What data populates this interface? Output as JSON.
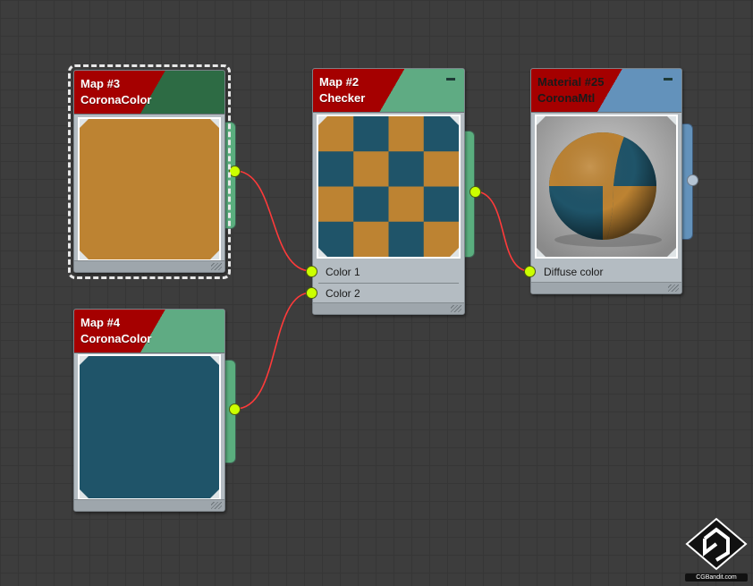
{
  "nodes": {
    "map3": {
      "title": "Map #3",
      "subtitle": "CoronaColor",
      "swatch": "#bd8332"
    },
    "map4": {
      "title": "Map #4",
      "subtitle": "CoronaColor",
      "swatch": "#1f5469"
    },
    "map2": {
      "title": "Map #2",
      "subtitle": "Checker",
      "slots": [
        "Color 1",
        "Color 2"
      ]
    },
    "material25": {
      "title": "Material #25",
      "subtitle": "CoronaMtl",
      "slots": [
        "Diffuse color"
      ]
    }
  },
  "colors": {
    "canvas": "#3d3d3d",
    "header_red": "#a50000",
    "map_header_green": "#2d6b44",
    "checker_header_green": "#5fab83",
    "material_header_blue": "#6392bb",
    "node_tab_green": "#5aae7e",
    "node_tab_blue": "#6392bb",
    "wire": "#ff3a3a",
    "socket": "#ccff00",
    "checker_orange": "#bd8332",
    "checker_teal": "#1f5469"
  },
  "watermark": {
    "text": "CGBandit.com"
  }
}
